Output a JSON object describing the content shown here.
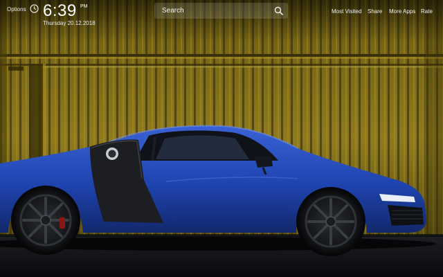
{
  "header": {
    "options_label": "Options",
    "time": "6:39",
    "ampm": "PM",
    "date": "Thursday 20.12.2018"
  },
  "search": {
    "placeholder": "Search"
  },
  "nav": {
    "links": [
      "Most Visited",
      "Share",
      "More Apps",
      "Rate"
    ]
  },
  "icons": {
    "clock": "clock-icon",
    "search": "search-icon"
  },
  "colors": {
    "container": "#8a7618",
    "car_body": "#2447b0",
    "ground": "#15171c"
  }
}
